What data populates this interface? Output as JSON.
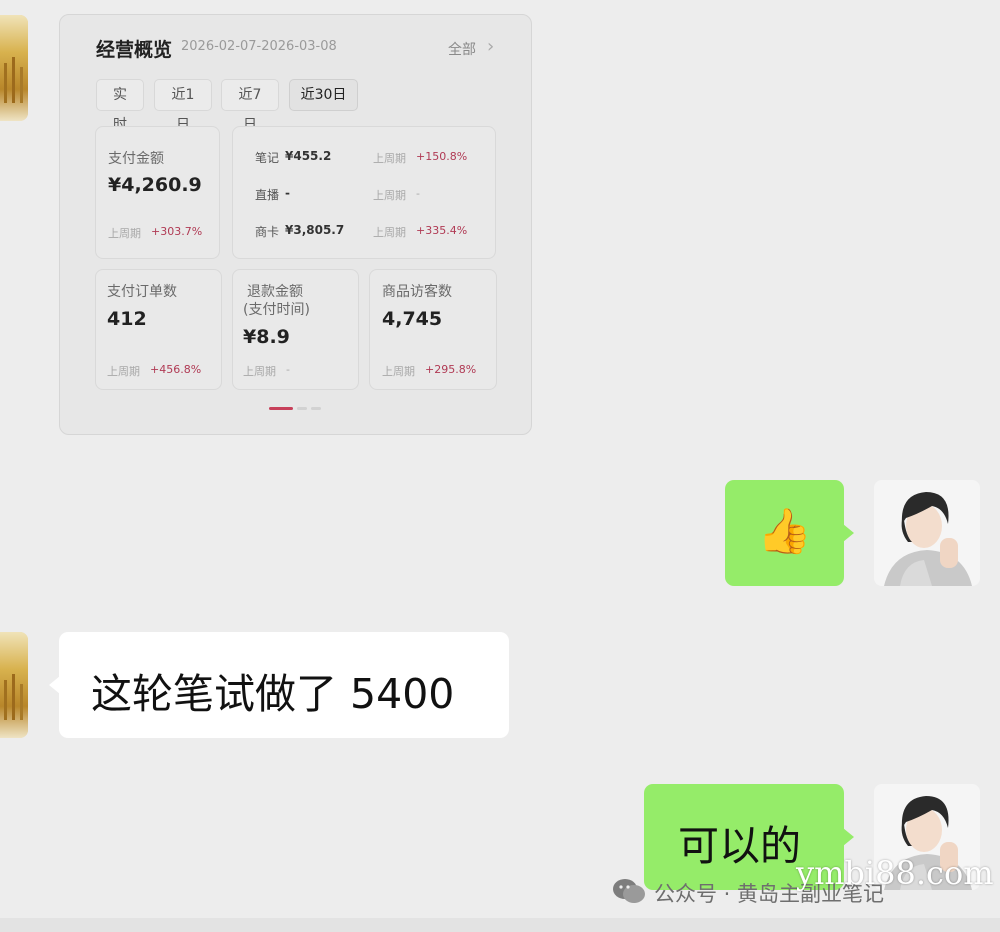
{
  "card": {
    "title": "经营概览",
    "date_range": "2026-02-07-2026-03-08",
    "all_label": "全部",
    "tabs": [
      "实时",
      "近1日",
      "近7日",
      "近30日"
    ],
    "active_tab": "近30日",
    "pay_amount": {
      "label": "支付金额",
      "value": "¥4,260.9",
      "prev_label": "上周期",
      "change": "+303.7%"
    },
    "breakdown": {
      "note_label": "笔记",
      "note_value": "¥455.2",
      "note_prev": "上周期",
      "note_change": "+150.8%",
      "live_label": "直播",
      "live_value": "-",
      "live_prev": "上周期",
      "live_change": "-",
      "card_label": "商卡",
      "card_value": "¥3,805.7",
      "card_prev": "上周期",
      "card_change": "+335.4%"
    },
    "orders": {
      "label": "支付订单数",
      "value": "412",
      "prev_label": "上周期",
      "change": "+456.8%"
    },
    "refund": {
      "label": "退款金额",
      "sub_label": "(支付时间)",
      "value": "¥8.9",
      "prev_label": "上周期",
      "change": "-"
    },
    "visitors": {
      "label": "商品访客数",
      "value": "4,745",
      "prev_label": "上周期",
      "change": "+295.8%"
    },
    "pager_active": 1,
    "pager_count": 3
  },
  "messages": [
    {
      "side": "right",
      "content": "👍"
    },
    {
      "side": "left",
      "content": "这轮笔试做了 5400"
    },
    {
      "side": "right",
      "content": "可以的"
    }
  ],
  "footer": {
    "source": "公众号 · 黄岛主副业笔记",
    "watermark": "ymbi88.com"
  },
  "colors": {
    "bubble_green": "#95ec69",
    "bubble_white": "#ffffff",
    "background": "#ededed",
    "accent_red": "#b03a54"
  }
}
